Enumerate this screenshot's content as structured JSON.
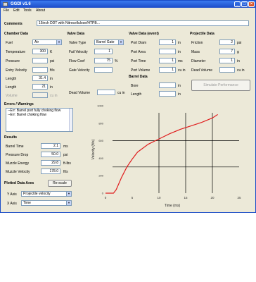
{
  "window": {
    "title": "GGDI v1.6",
    "close": "×",
    "minimize": "_",
    "maximize": "□"
  },
  "menu": [
    "File",
    "Edit",
    "Tools",
    "About"
  ],
  "comments": {
    "label": "Comments",
    "value": "15inch DDT with Nitrocellulose/HTPB..."
  },
  "chamber": {
    "title": "Chamber Data",
    "fields": [
      {
        "label": "Fuel",
        "value": "Air",
        "type": "select"
      },
      {
        "label": "Temperature",
        "value": "300",
        "unit": "K"
      },
      {
        "label": "Pressure",
        "value": "",
        "unit": "psi"
      },
      {
        "label": "Entry Velocity",
        "value": "",
        "unit": "ft/s"
      },
      {
        "label": "Length",
        "value": "31.4",
        "unit": "in"
      },
      {
        "label": "Length",
        "value": "21",
        "unit": "in"
      },
      {
        "label": "Volume",
        "value": "",
        "unit": "cu in",
        "disabled": true
      }
    ]
  },
  "valve": {
    "title": "Valve Data",
    "fields": [
      {
        "label": "Valve Type",
        "value": "Barrel Gate",
        "type": "select"
      },
      {
        "label": "Fail Velocity",
        "value": "1",
        "unit": ""
      },
      {
        "label": "Flow Coef",
        "value": "75",
        "unit": "%"
      },
      {
        "label": "Gate Velocity",
        "value": "",
        "unit": ""
      }
    ],
    "dead_volume": {
      "label": "Dead Volume",
      "value": "",
      "unit": "cu in"
    }
  },
  "valve_event": {
    "title": "Valve Data (event)",
    "fields": [
      {
        "label": "Port Diam",
        "value": "1",
        "unit": "in"
      },
      {
        "label": "Port Area",
        "value": "",
        "unit": "in"
      },
      {
        "label": "Port Time",
        "value": "1",
        "unit": "ms"
      },
      {
        "label": "Port Volume",
        "value": "1",
        "unit": "cu in"
      }
    ]
  },
  "barrel": {
    "title": "Barrel Data",
    "fields": [
      {
        "label": "Bore",
        "value": "",
        "unit": "in"
      },
      {
        "label": "Length",
        "value": "",
        "unit": "in"
      }
    ]
  },
  "projectile": {
    "title": "Projectile Data",
    "fields": [
      {
        "label": "Friction",
        "value": "2",
        "unit": "psi"
      },
      {
        "label": "Mass",
        "value": "7",
        "unit": "g"
      },
      {
        "label": "Diameter",
        "value": "1",
        "unit": "in"
      },
      {
        "label": "Dead Volume",
        "value": "",
        "unit": "cu in"
      }
    ],
    "action_button": "Simulate Performance"
  },
  "errors": {
    "title": "Errors / Warnings",
    "lines": [
      "--Err: Barrel port fully choking flow",
      "--Err: Barrel choking flow"
    ]
  },
  "results": {
    "title": "Results",
    "fields": [
      {
        "label": "Barrel Time",
        "value": "2.1",
        "unit": "ms"
      },
      {
        "label": "Pressure Drop",
        "value": "50.0",
        "unit": "psi"
      },
      {
        "label": "Muzzle Energy",
        "value": "29.8",
        "unit": "ft-lbs"
      },
      {
        "label": "Muzzle Velocity",
        "value": "178.0",
        "unit": "ft/s"
      }
    ]
  },
  "plotted": {
    "title": "Plotted Data Axes",
    "calc_button": "Re-scale",
    "y_axis": {
      "label": "Y Axis",
      "value": "Projectile velocity"
    },
    "x_axis": {
      "label": "X Axis",
      "value": "Time"
    }
  },
  "colors": {
    "curve": "#e02020",
    "title_bar": "#245edb",
    "grid": "#000000"
  },
  "chart_data": {
    "type": "line",
    "xlabel": "Time (ms)",
    "ylabel": "Velocity (ft/s)",
    "xlim": [
      0,
      25
    ],
    "ylim": [
      0,
      1000
    ],
    "x_ticks": [
      "0",
      "5",
      "10",
      "15",
      "20",
      "25"
    ],
    "y_ticks": [
      "0",
      "200",
      "400",
      "600",
      "800",
      "1000"
    ],
    "grid": "partial",
    "series": [
      {
        "x": [
          0,
          1.5,
          2,
          3,
          4,
          5,
          6,
          8,
          10,
          12,
          14,
          16,
          18,
          20,
          21
        ],
        "y": [
          0,
          0,
          40,
          180,
          300,
          390,
          470,
          560,
          620,
          680,
          730,
          770,
          810,
          860,
          900
        ]
      }
    ]
  }
}
